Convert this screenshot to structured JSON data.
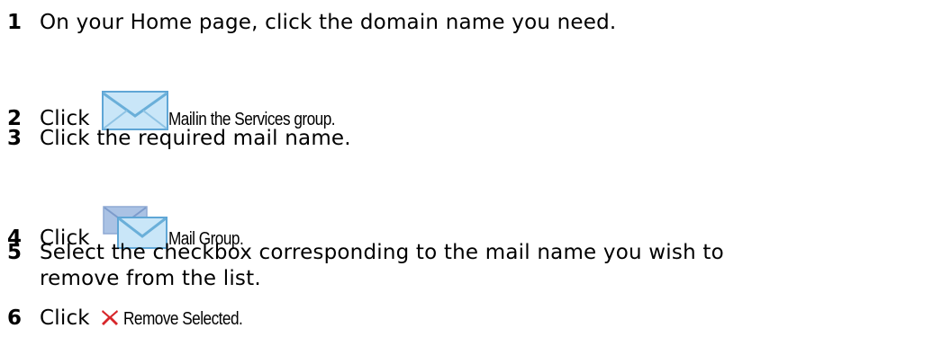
{
  "steps": [
    {
      "number": "1",
      "text": "On your Home page, click the domain name you need."
    },
    {
      "number": "2",
      "before": "Click",
      "icon": "mail-envelope-icon",
      "ui_label": "Mail",
      "after": " in the Services group."
    },
    {
      "number": "3",
      "text": "Click the required mail name."
    },
    {
      "number": "4",
      "before": "Click",
      "icon": "mail-group-icon",
      "ui_label": "Mail Group."
    },
    {
      "number": "5",
      "text": "Select the checkbox corresponding to the mail name you wish to",
      "text_cont": "remove from the list."
    },
    {
      "number": "6",
      "before": "Click",
      "icon": "red-x-icon",
      "ui_label": "Remove Selected."
    }
  ]
}
